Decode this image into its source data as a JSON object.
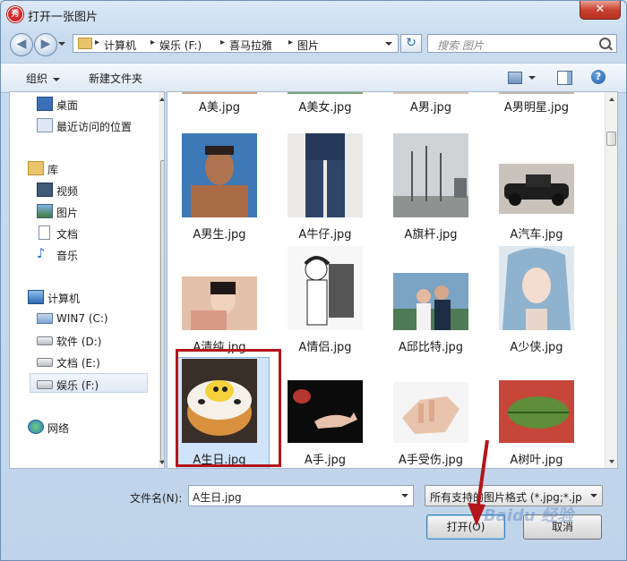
{
  "window": {
    "title": "打开一张图片",
    "app_icon_text": "秀",
    "close_glyph": "✕"
  },
  "nav": {
    "back_glyph": "◀",
    "forward_glyph": "▶",
    "breadcrumb": [
      "计算机",
      "娱乐 (F:)",
      "喜马拉雅",
      "图片"
    ],
    "breadcrumb_sep": "▸",
    "refresh_glyph": "↻",
    "search_placeholder": "搜索 图片"
  },
  "toolbar": {
    "organize": "组织",
    "new_folder": "新建文件夹",
    "help_glyph": "?"
  },
  "sidebar": {
    "items": [
      {
        "label": "桌面",
        "icon": "desktop-icon"
      },
      {
        "label": "最近访问的位置",
        "icon": "recent-icon"
      },
      {
        "label": "库",
        "icon": "library-icon"
      },
      {
        "label": "视频",
        "icon": "video-icon"
      },
      {
        "label": "图片",
        "icon": "pictures-icon"
      },
      {
        "label": "文档",
        "icon": "documents-icon"
      },
      {
        "label": "音乐",
        "icon": "music-icon"
      },
      {
        "label": "计算机",
        "icon": "computer-icon"
      },
      {
        "label": "WIN7 (C:)",
        "icon": "drive-icon"
      },
      {
        "label": "软件 (D:)",
        "icon": "drive-icon"
      },
      {
        "label": "文档 (E:)",
        "icon": "drive-icon"
      },
      {
        "label": "娱乐 (F:)",
        "icon": "drive-icon",
        "selected": true
      },
      {
        "label": "网络",
        "icon": "network-icon"
      }
    ]
  },
  "files": {
    "row0": [
      "A美.jpg",
      "A美女.jpg",
      "A男.jpg",
      "A男明星.jpg"
    ],
    "row1": [
      "A男生.jpg",
      "A牛仔.jpg",
      "A旗杆.jpg",
      "A汽车.jpg"
    ],
    "row2": [
      "A清纯.jpg",
      "A情侣.jpg",
      "A邱比特.jpg",
      "A少侠.jpg"
    ],
    "row3": [
      "A生日.jpg",
      "A手.jpg",
      "A手受伤.jpg",
      "A树叶.jpg"
    ],
    "selected": "A生日.jpg"
  },
  "footer": {
    "filename_label": "文件名(N):",
    "filename_value": "A生日.jpg",
    "filter_value": "所有支持的图片格式 (*.jpg;*.jp",
    "open_button": "打开(O)",
    "cancel_button": "取消"
  },
  "watermark": "Baidu 经验",
  "colors": {
    "highlight_red": "#b3151a",
    "selection_blue": "#cfe3fa",
    "accent": "#3c7fb1"
  }
}
